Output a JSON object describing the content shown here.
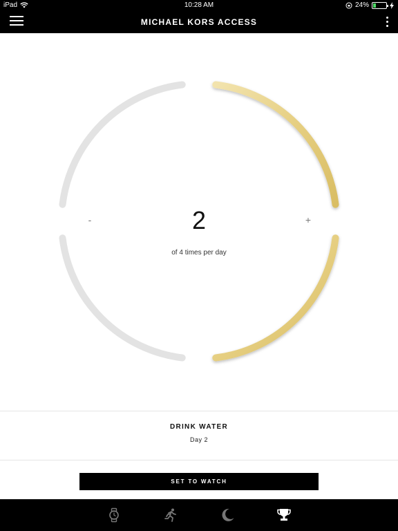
{
  "status_bar": {
    "device": "iPad",
    "time": "10:28 AM",
    "battery": "24%",
    "battery_level": 0.24,
    "icons": [
      "wifi-icon",
      "lock-rotation-icon",
      "battery-icon",
      "charging-icon"
    ]
  },
  "header": {
    "title": "MICHAEL KORS ACCESS",
    "menu_icon": "hamburger-menu-icon",
    "more_icon": "more-vertical-icon"
  },
  "goal_ring": {
    "value": "2",
    "subtitle": "of 4 times per day",
    "minus_label": "-",
    "plus_label": "+",
    "current": 2,
    "target": 4,
    "active_color": "#e6cf82",
    "inactive_color": "#e3e3e3"
  },
  "goal": {
    "title": "DRINK WATER",
    "day": "Day 2"
  },
  "action": {
    "set_to_watch_label": "SET TO WATCH"
  },
  "tab_bar": {
    "tabs": [
      "watch-icon",
      "activity-runner-icon",
      "sleep-moon-icon",
      "goals-trophy-icon"
    ],
    "active": "goals-trophy-icon"
  }
}
